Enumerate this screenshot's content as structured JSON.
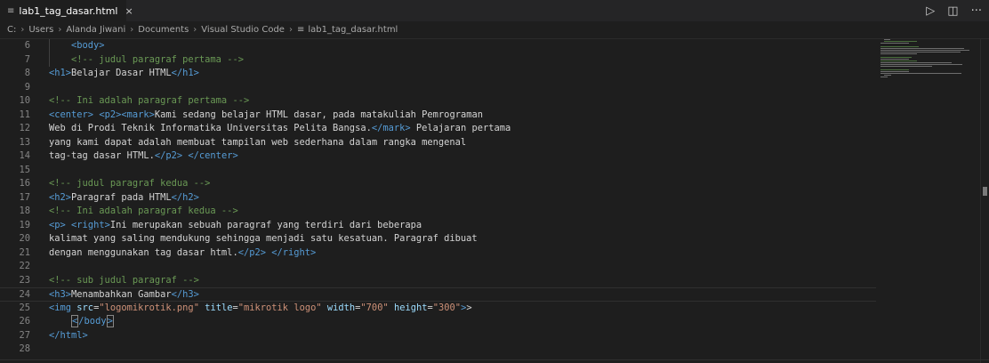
{
  "tab": {
    "file_icon": "≡",
    "title": "lab1_tag_dasar.html",
    "close": "×"
  },
  "actions": {
    "run": "▷",
    "split": "◫",
    "more": "···"
  },
  "breadcrumb": {
    "items": [
      "C:",
      "Users",
      "Alanda Jiwani",
      "Documents",
      "Visual Studio Code"
    ],
    "file_icon": "≡",
    "file": "lab1_tag_dasar.html",
    "separator": "›"
  },
  "lines": [
    {
      "n": "6",
      "indent": "    ",
      "parts": [
        [
          "tag",
          "<body>"
        ]
      ]
    },
    {
      "n": "7",
      "indent": "    ",
      "parts": [
        [
          "cmt",
          "<!-- judul paragraf pertama -->"
        ]
      ]
    },
    {
      "n": "8",
      "indent": "",
      "parts": [
        [
          "tag",
          "<h1>"
        ],
        [
          "txt",
          "Belajar Dasar HTML"
        ],
        [
          "tag",
          "</h1>"
        ]
      ]
    },
    {
      "n": "9",
      "indent": "",
      "parts": []
    },
    {
      "n": "10",
      "indent": "",
      "parts": [
        [
          "cmt",
          "<!-- Ini adalah paragraf pertama -->"
        ]
      ]
    },
    {
      "n": "11",
      "indent": "",
      "parts": [
        [
          "tag",
          "<center>"
        ],
        [
          "txt",
          " "
        ],
        [
          "tag",
          "<p2>"
        ],
        [
          "tag",
          "<mark>"
        ],
        [
          "txt",
          "Kami sedang belajar HTML dasar, pada matakuliah Pemrograman"
        ]
      ]
    },
    {
      "n": "12",
      "indent": "",
      "parts": [
        [
          "txt",
          "Web di Prodi Teknik Informatika Universitas Pelita Bangsa."
        ],
        [
          "tag",
          "</mark>"
        ],
        [
          "txt",
          " Pelajaran pertama"
        ]
      ]
    },
    {
      "n": "13",
      "indent": "",
      "parts": [
        [
          "txt",
          "yang kami dapat adalah membuat tampilan web sederhana dalam rangka mengenal"
        ]
      ]
    },
    {
      "n": "14",
      "indent": "",
      "parts": [
        [
          "txt",
          "tag-tag dasar HTML."
        ],
        [
          "tag",
          "</p2>"
        ],
        [
          "txt",
          " "
        ],
        [
          "tag",
          "</center>"
        ]
      ]
    },
    {
      "n": "15",
      "indent": "",
      "parts": []
    },
    {
      "n": "16",
      "indent": "",
      "parts": [
        [
          "cmt",
          "<!-- judul paragraf kedua -->"
        ]
      ]
    },
    {
      "n": "17",
      "indent": "",
      "parts": [
        [
          "tag",
          "<h2>"
        ],
        [
          "txt",
          "Paragraf pada HTML"
        ],
        [
          "tag",
          "</h2>"
        ]
      ]
    },
    {
      "n": "18",
      "indent": "",
      "parts": [
        [
          "cmt",
          "<!-- Ini adalah paragraf kedua -->"
        ]
      ]
    },
    {
      "n": "19",
      "indent": "",
      "parts": [
        [
          "tag",
          "<p>"
        ],
        [
          "txt",
          " "
        ],
        [
          "tag",
          "<right>"
        ],
        [
          "txt",
          "Ini merupakan sebuah paragraf yang terdiri dari beberapa"
        ]
      ]
    },
    {
      "n": "20",
      "indent": "",
      "parts": [
        [
          "txt",
          "kalimat yang saling mendukung sehingga menjadi satu kesatuan. Paragraf dibuat"
        ]
      ]
    },
    {
      "n": "21",
      "indent": "",
      "parts": [
        [
          "txt",
          "dengan menggunakan tag dasar html."
        ],
        [
          "tag",
          "</p2>"
        ],
        [
          "txt",
          " "
        ],
        [
          "tag",
          "</right>"
        ]
      ]
    },
    {
      "n": "22",
      "indent": "",
      "parts": []
    },
    {
      "n": "23",
      "indent": "",
      "parts": [
        [
          "cmt",
          "<!-- sub judul paragraf -->"
        ]
      ]
    },
    {
      "n": "24",
      "indent": "",
      "parts": [
        [
          "tag",
          "<h3>"
        ],
        [
          "txt",
          "Menambahkan Gambar"
        ],
        [
          "tag",
          "</h3>"
        ]
      ]
    },
    {
      "n": "25",
      "indent": "",
      "parts": [
        [
          "tag",
          "<img"
        ],
        [
          "txt",
          " "
        ],
        [
          "attr",
          "src"
        ],
        [
          "eq",
          "="
        ],
        [
          "str",
          "\"logomikrotik.png\""
        ],
        [
          "txt",
          " "
        ],
        [
          "attr",
          "title"
        ],
        [
          "eq",
          "="
        ],
        [
          "str",
          "\"mikrotik logo\""
        ],
        [
          "txt",
          " "
        ],
        [
          "attr",
          "width"
        ],
        [
          "eq",
          "="
        ],
        [
          "str",
          "\"700\""
        ],
        [
          "txt",
          " "
        ],
        [
          "attr",
          "height"
        ],
        [
          "eq",
          "="
        ],
        [
          "str",
          "\"300\""
        ],
        [
          "tag",
          ">"
        ],
        [
          "txt",
          ">"
        ]
      ]
    },
    {
      "n": "26",
      "indent": "    ",
      "parts": [
        [
          "cur",
          "<"
        ],
        [
          "tag",
          "/body"
        ],
        [
          "cur",
          ">"
        ]
      ]
    },
    {
      "n": "27",
      "indent": "",
      "parts": [
        [
          "tag",
          "</html>"
        ]
      ]
    },
    {
      "n": "28",
      "indent": "",
      "parts": []
    }
  ]
}
